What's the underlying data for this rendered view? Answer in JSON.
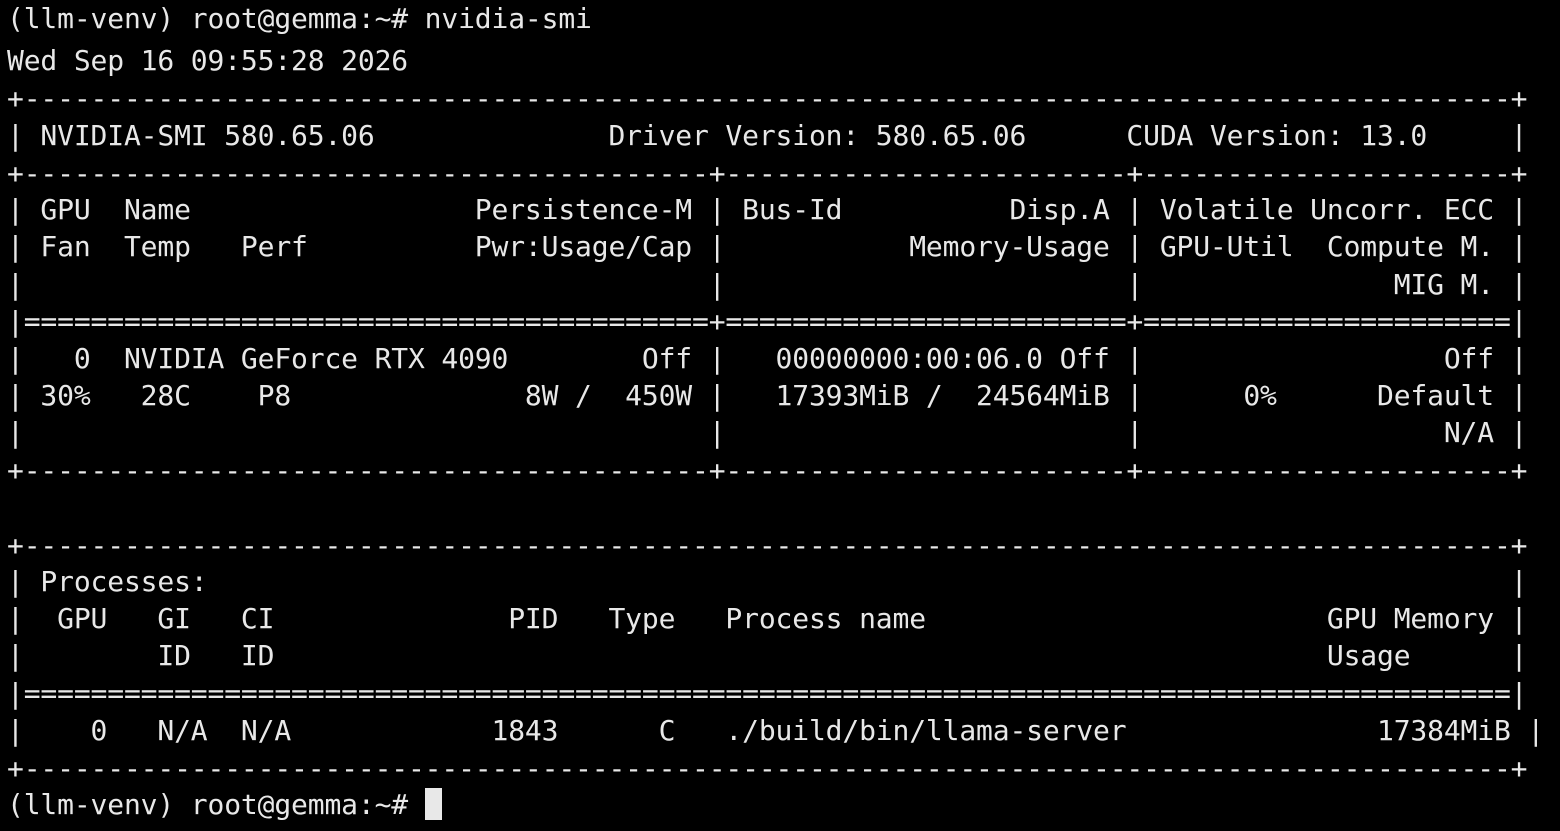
{
  "terminal": {
    "command_line": "(llm-venv) root@gemma:~# nvidia-smi",
    "timestamp": "Wed Sep 16 09:55:28 2026",
    "prompt": "(llm-venv) root@gemma:~# ",
    "cursor_icon": "block-cursor",
    "lines": [
      "+-----------------------------------------------------------------------------------------+",
      "| NVIDIA-SMI 580.65.06              Driver Version: 580.65.06      CUDA Version: 13.0     |",
      "+-----------------------------------------+------------------------+----------------------+",
      "| GPU  Name                 Persistence-M | Bus-Id          Disp.A | Volatile Uncorr. ECC |",
      "| Fan  Temp   Perf          Pwr:Usage/Cap |           Memory-Usage | GPU-Util  Compute M. |",
      "|                                         |                        |               MIG M. |",
      "|=========================================+========================+======================|",
      "|   0  NVIDIA GeForce RTX 4090        Off |   00000000:00:06.0 Off |                  Off |",
      "| 30%   28C    P8              8W /  450W |   17393MiB /  24564MiB |      0%      Default |",
      "|                                         |                        |                  N/A |",
      "+-----------------------------------------+------------------------+----------------------+",
      "",
      "+-----------------------------------------------------------------------------------------+",
      "| Processes:                                                                              |",
      "|  GPU   GI   CI              PID   Type   Process name                        GPU Memory |",
      "|        ID   ID                                                               Usage      |",
      "|=========================================================================================|",
      "|    0   N/A  N/A            1843      C   ./build/bin/llama-server               17384MiB |",
      "+-----------------------------------------------------------------------------------------+"
    ]
  }
}
